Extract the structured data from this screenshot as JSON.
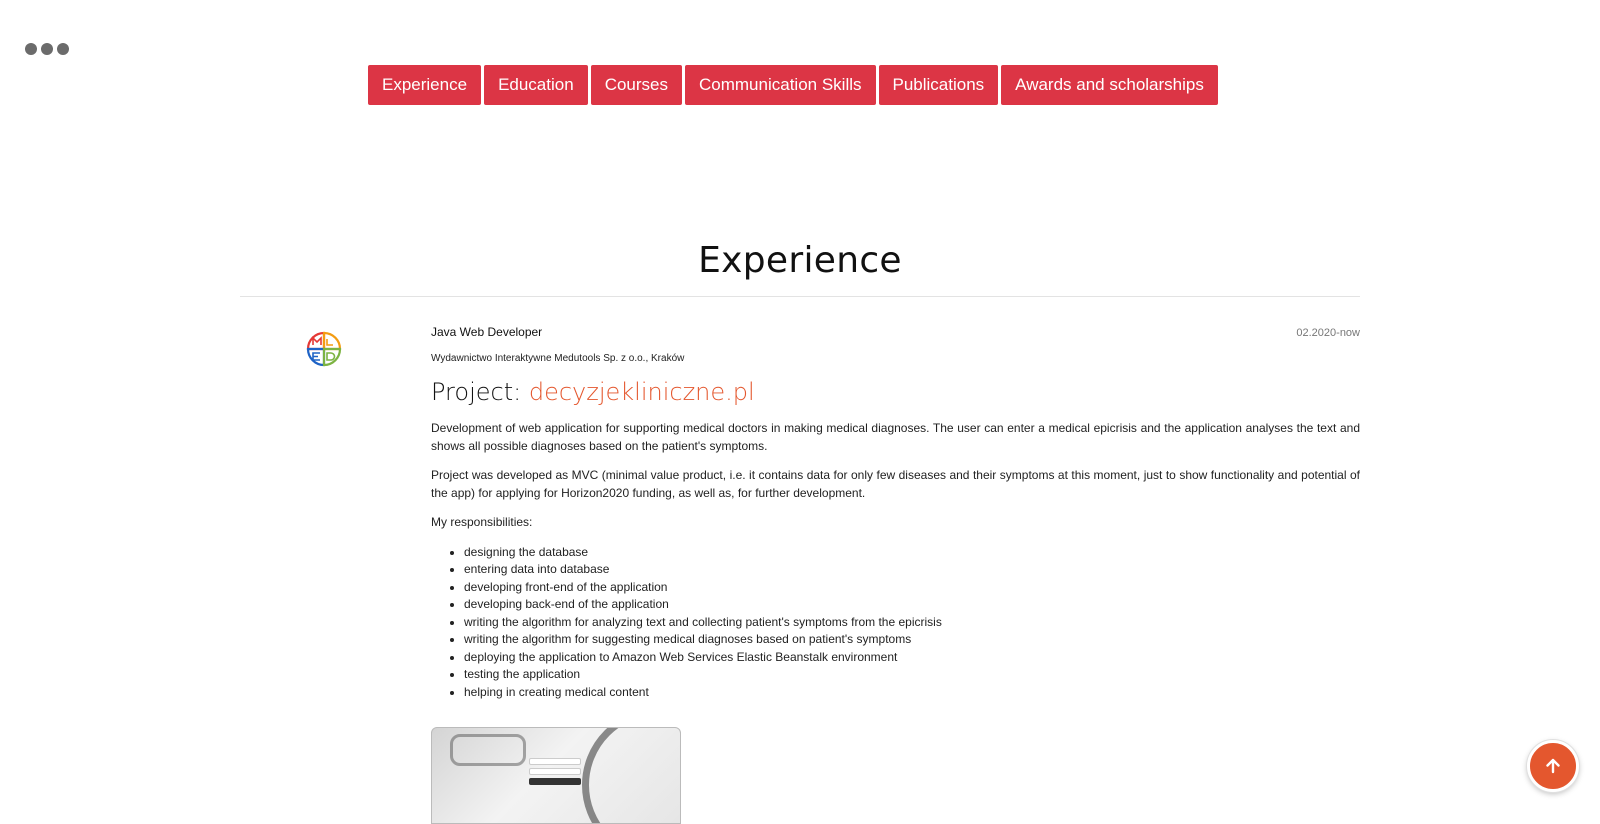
{
  "nav": {
    "items": [
      {
        "label": "Experience"
      },
      {
        "label": "Education"
      },
      {
        "label": "Courses"
      },
      {
        "label": "Communication Skills"
      },
      {
        "label": "Publications"
      },
      {
        "label": "Awards and scholarships"
      }
    ]
  },
  "colors": {
    "accent": "#dc3545",
    "link": "#e4572e"
  },
  "section": {
    "title": "Experience"
  },
  "job": {
    "title": "Java Web Developer",
    "date": "02.2020-now",
    "company": "Wydawnictwo Interaktywne Medutools Sp. z o.o., Kraków",
    "project_prefix": "Project: ",
    "project_link": "decyzjekliniczne.pl",
    "paragraphs": [
      "Development of web application for supporting medical doctors in making medical diagnoses. The user can enter a medical epicrisis and the application analyses the text and shows all possible diagnoses based on the patient's symptoms.",
      "Project was developed as MVC (minimal value product, i.e. it contains data for only few diseases and their symptoms at this moment, just to show functionality and potential of the app) for applying for Horizon2020 funding, as well as, for further development.",
      "My responsibilities:"
    ],
    "responsibilities": [
      "designing the database",
      "entering data into database",
      "developing front-end of the application",
      "developing back-end of the application",
      "writing the algorithm for analyzing text and collecting patient's symptoms from the epicrisis",
      "writing the algorithm for suggesting medical diagnoses based on patient's symptoms",
      "deploying the application to Amazon Web Services Elastic Beanstalk environment",
      "testing the application",
      "helping in creating medical content"
    ]
  },
  "icons": {
    "scroll_top": "arrow-up-icon",
    "window_menu": "more-dots-icon",
    "company_logo": "medutools-logo"
  }
}
